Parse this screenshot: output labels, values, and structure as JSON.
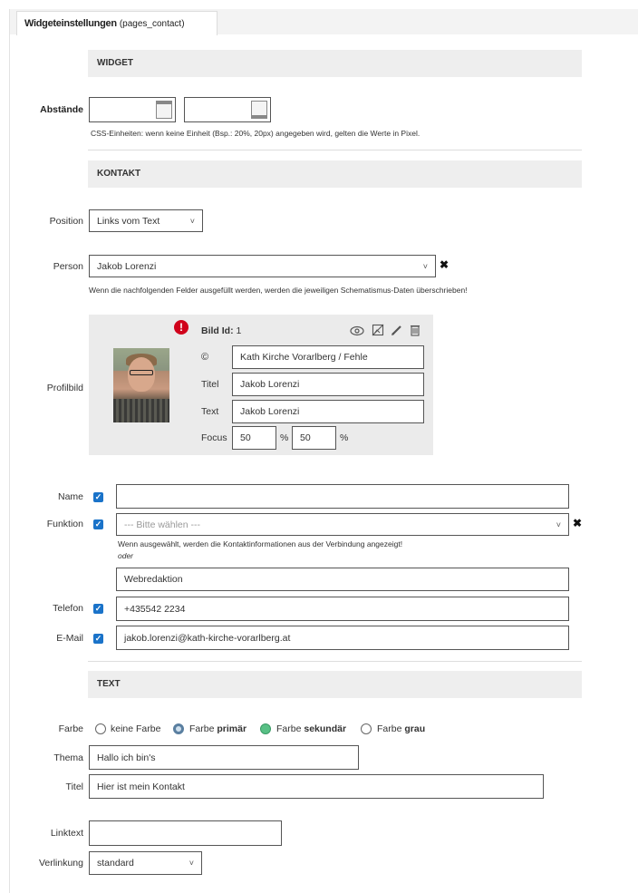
{
  "tab": {
    "title": "Widgeteinstellungen",
    "subtitle": "(pages_contact)"
  },
  "widget": {
    "section_title": "WIDGET",
    "spacing_label": "Abstände",
    "spacing_hint": "CSS-Einheiten: wenn keine Einheit (Bsp.: 20%, 20px) angegeben wird, gelten die Werte in Pixel."
  },
  "kontakt": {
    "section_title": "KONTAKT",
    "position_label": "Position",
    "position_value": "Links vom Text",
    "person_label": "Person",
    "person_value": "Jakob Lorenzi",
    "person_hint": "Wenn die nachfolgenden Felder ausgefüllt werden, werden die jeweiligen Schematismus-Daten überschrieben!",
    "profilbild_label": "Profilbild",
    "image": {
      "id_label": "Bild Id:",
      "id_value": "1",
      "copyright_label": "©",
      "copyright_value": "Kath Kirche Vorarlberg / Fehle",
      "title_label": "Titel",
      "title_value": "Jakob Lorenzi",
      "text_label": "Text",
      "text_value": "Jakob Lorenzi",
      "focus_label": "Focus",
      "focus_x": "50",
      "focus_y": "50",
      "percent": "%",
      "alert_glyph": "!"
    },
    "name_label": "Name",
    "name_value": "",
    "funktion_label": "Funktion",
    "funktion_placeholder": "--- Bitte wählen ---",
    "funktion_hint": "Wenn ausgewählt, werden die Kontaktinformationen aus der Verbindung angezeigt!",
    "oder": "oder",
    "funktion_text": "Webredaktion",
    "telefon_label": "Telefon",
    "telefon_value": "+435542 2234",
    "email_label": "E-Mail",
    "email_value": "jakob.lorenzi@kath-kirche-vorarlberg.at"
  },
  "text": {
    "section_title": "TEXT",
    "farbe_label": "Farbe",
    "farbe_options": [
      {
        "prefix": "keine Farbe",
        "bold": ""
      },
      {
        "prefix": "Farbe",
        "bold": "primär"
      },
      {
        "prefix": "Farbe",
        "bold": "sekundär"
      },
      {
        "prefix": "Farbe",
        "bold": "grau"
      }
    ],
    "thema_label": "Thema",
    "thema_value": "Hallo ich bin's",
    "titel_label": "Titel",
    "titel_value": "Hier ist mein Kontakt",
    "linktext_label": "Linktext",
    "linktext_value": "",
    "verlinkung_label": "Verlinkung",
    "verlinkung_value": "standard"
  },
  "icons": {
    "chevron": "˅",
    "remove": "✖",
    "check": "✓"
  },
  "colors": {
    "checkbox": "#1a73c9",
    "alert": "#d0021b",
    "radio_green": "#58c085",
    "section_bg": "#eeeeee",
    "image_panel_bg": "#ebebeb"
  }
}
